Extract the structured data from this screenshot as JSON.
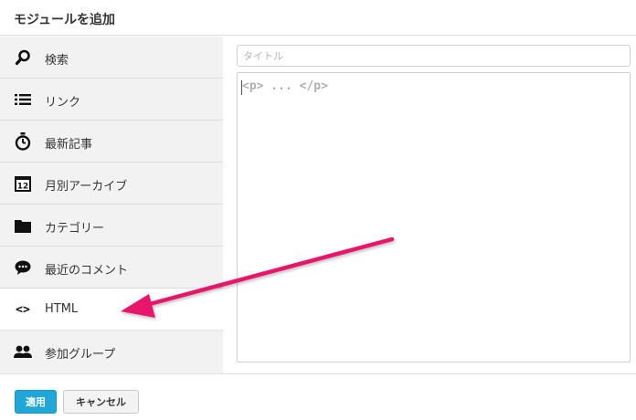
{
  "dialog": {
    "title": "モジュールを追加"
  },
  "sidebar": {
    "items": [
      {
        "label": "検索",
        "icon": "search-icon"
      },
      {
        "label": "リンク",
        "icon": "list-icon"
      },
      {
        "label": "最新記事",
        "icon": "stopwatch-icon"
      },
      {
        "label": "月別アーカイブ",
        "icon": "calendar-icon",
        "icon_text": "12"
      },
      {
        "label": "カテゴリー",
        "icon": "folder-icon"
      },
      {
        "label": "最近のコメント",
        "icon": "comment-icon"
      },
      {
        "label": "HTML",
        "icon": "code-icon",
        "icon_text": "<>",
        "selected": true
      },
      {
        "label": "参加グループ",
        "icon": "group-icon"
      }
    ]
  },
  "editor": {
    "title_placeholder": "タイトル",
    "body_placeholder": "<p> ... </p>"
  },
  "footer": {
    "apply_label": "適用",
    "cancel_label": "キャンセル"
  },
  "colors": {
    "apply_button": "#20a7d8",
    "annotation_arrow": "#e8196b",
    "sidebar_bg": "#f2f2f2"
  }
}
